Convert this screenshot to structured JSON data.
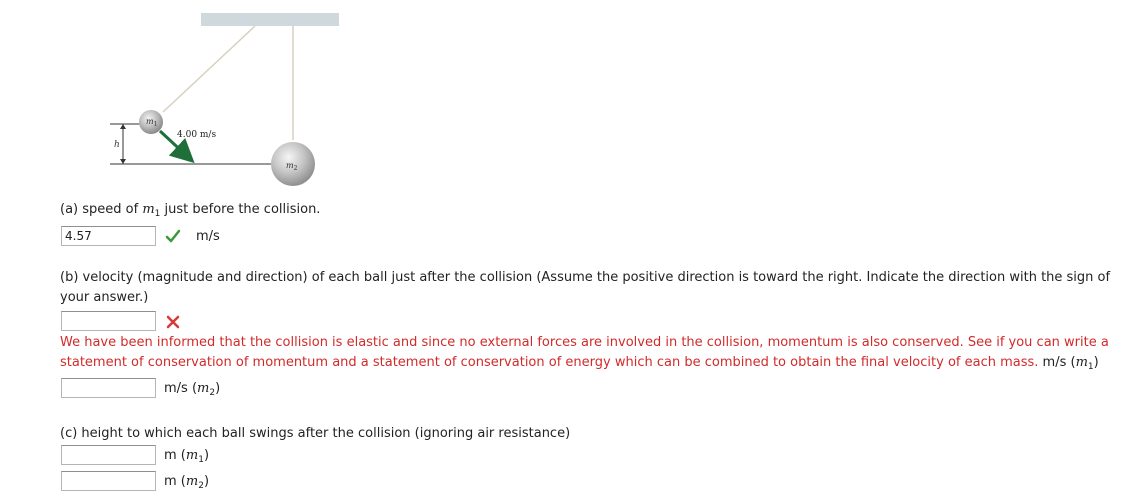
{
  "figure": {
    "ball1_label": "m",
    "ball1_sub": "1",
    "ball2_label": "m",
    "ball2_sub": "2",
    "velocity_label": "4.00 m/s",
    "height_label": "h",
    "arrow_color": "#1f6f3a"
  },
  "part_a": {
    "prompt_pre": "(a) speed of ",
    "prompt_var": "m",
    "prompt_sub": "1",
    "prompt_post": " just before the collision.",
    "answer_value": "4.57",
    "unit": "m/s",
    "status_icon": "checkmark-icon"
  },
  "part_b": {
    "prompt": "(b) velocity (magnitude and direction) of each ball just after the collision (Assume the positive direction is toward the right. Indicate the direction with the sign of your answer.)",
    "answer1_value": "",
    "status_icon": "cross-icon",
    "feedback": "We have been informed that the collision is elastic and since no external forces are involved in the collision, momentum is also conserved. See if you can write a statement of conservation of momentum and a statement of conservation of energy which can be combined to obtain the final velocity of each mass.",
    "unit1": "m/s (",
    "unit1_var": "m",
    "unit1_sub": "1",
    "unit1_close": ")",
    "answer2_value": "",
    "unit2": "m/s (",
    "unit2_var": "m",
    "unit2_sub": "2",
    "unit2_close": ")"
  },
  "part_c": {
    "prompt": "(c) height to which each ball swings after the collision (ignoring air resistance)",
    "answer1_value": "",
    "unit1": "m (",
    "unit1_var": "m",
    "unit1_sub": "1",
    "unit1_close": ")",
    "answer2_value": "",
    "unit2": "m (",
    "unit2_var": "m",
    "unit2_sub": "2",
    "unit2_close": ")"
  },
  "colors": {
    "feedback_red": "#d22a2a",
    "check_green": "#3a9a3a",
    "cross_red": "#d63a3a"
  }
}
